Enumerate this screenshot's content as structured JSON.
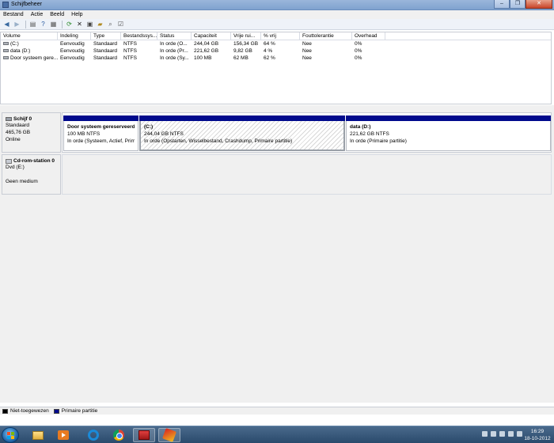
{
  "window": {
    "title": "Schijfbeheer",
    "buttons": [
      "–",
      "❐",
      "✕"
    ]
  },
  "menu": [
    "Bestand",
    "Actie",
    "Beeld",
    "Help"
  ],
  "toolbar": [
    "back-icon",
    "forward-icon",
    "list-view-icon",
    "help-icon",
    "properties-icon",
    "refresh-icon",
    "delete-icon",
    "format-icon",
    "open-icon",
    "search-icon",
    "options-icon"
  ],
  "volumes": {
    "columns": [
      "Volume",
      "Indeling",
      "Type",
      "Bestandssys...",
      "Status",
      "Capaciteit",
      "Vrije rui...",
      "% vrij",
      "Fouttolerantie",
      "Overhead"
    ],
    "rows": [
      [
        "(C:)",
        "Eenvoudig",
        "Standaard",
        "NTFS",
        "In orde (O...",
        "244,04 GB",
        "156,34 GB",
        "64 %",
        "Nee",
        "0%"
      ],
      [
        "data (D:)",
        "Eenvoudig",
        "Standaard",
        "NTFS",
        "In orde (Pr...",
        "221,62 GB",
        "9,82 GB",
        "4 %",
        "Nee",
        "0%"
      ],
      [
        "Door systeem gere...",
        "Eenvoudig",
        "Standaard",
        "NTFS",
        "In orde (Sy...",
        "100 MB",
        "62 MB",
        "62 %",
        "Nee",
        "0%"
      ]
    ]
  },
  "disks": [
    {
      "name": "Schijf 0",
      "lines": [
        "Standaard",
        "465,76 GB",
        "Online"
      ],
      "partitions": [
        {
          "name": "Door systeem gereserveerd",
          "size": "100 MB NTFS",
          "status": "In orde (Systeem, Actief, Prima"
        },
        {
          "name": "(C:)",
          "size": "244,04 GB NTFS",
          "status": "In orde (Opstarten, Wisselbestand, Crashdump, Primaire partitie)"
        },
        {
          "name": "data  (D:)",
          "size": "221,62 GB NTFS",
          "status": "In orde (Primaire partitie)"
        }
      ]
    },
    {
      "name": "Cd-rom-station 0",
      "lines": [
        "Dvd (E:)",
        "",
        "Geen medium"
      ]
    }
  ],
  "legend": [
    {
      "label": "Niet-toegewezen",
      "color": "#000000"
    },
    {
      "label": "Primaire partitie",
      "color": "#000a8c"
    }
  ],
  "taskbar": {
    "clock_time": "16:29",
    "clock_date": "18-10-2012"
  }
}
